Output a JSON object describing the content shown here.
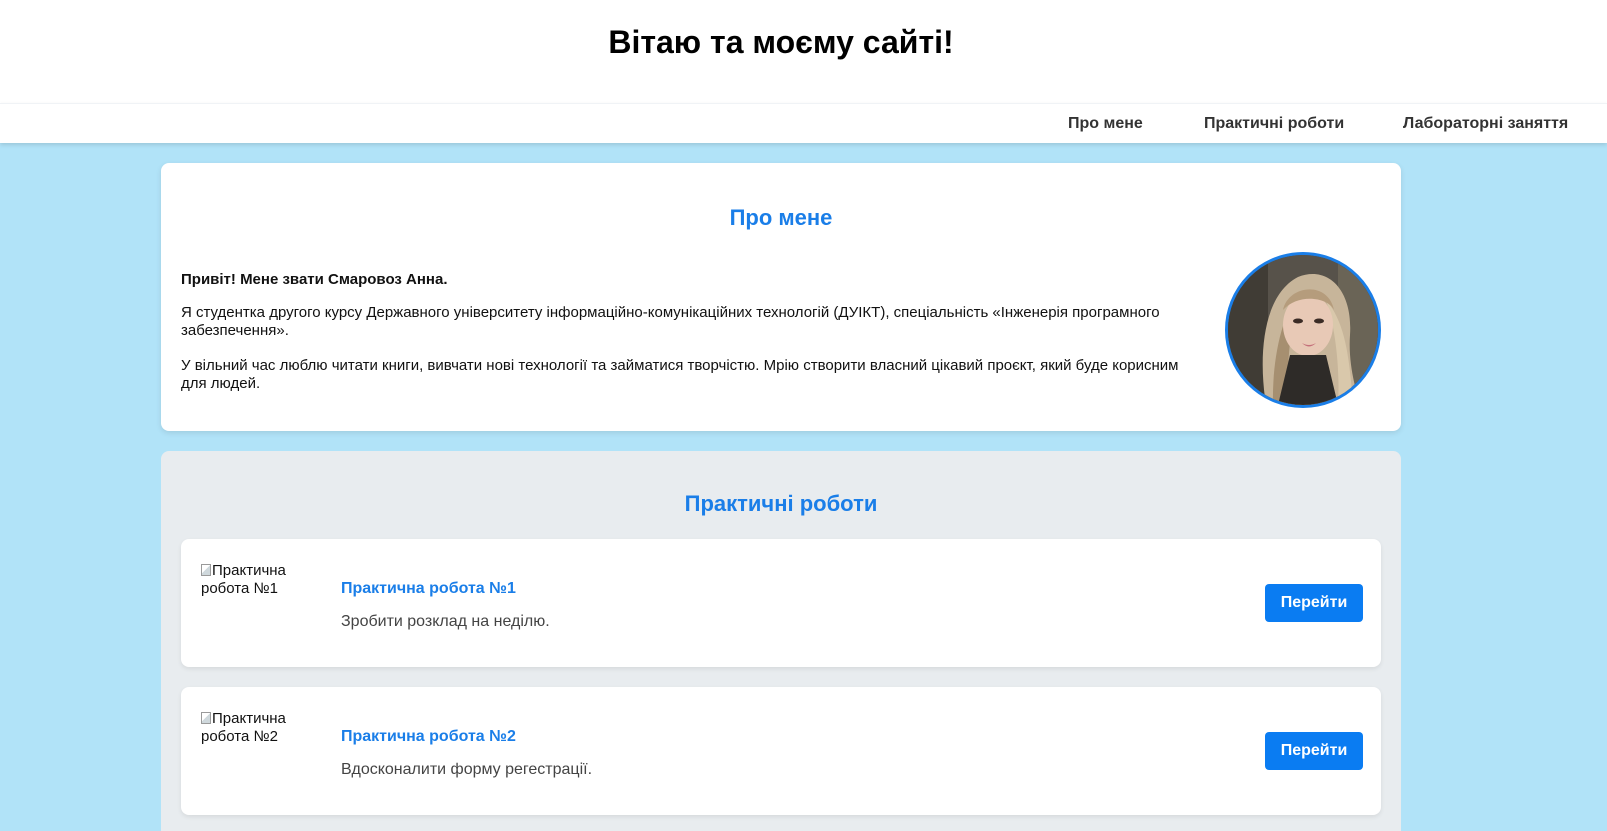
{
  "header": {
    "title": "Вітаю та моєму сайті!"
  },
  "nav": {
    "items": [
      {
        "label": "Про мене"
      },
      {
        "label": "Практичні роботи"
      },
      {
        "label": "Лабораторні заняття"
      }
    ]
  },
  "about": {
    "title": "Про мене",
    "greeting": "Привіт! Мене звати Смаровоз Анна.",
    "paragraph1": "Я студентка другого курсу Державного університету інформаційно-комунікаційних технологій (ДУІКТ), спеціальність «Інженерія програмного забезпечення».",
    "paragraph2": "У вільний час люблю читати книги, вивчати нові технології та займатися творчістю. Мрію створити власний цікавий проєкт, який буде корисним для людей."
  },
  "works": {
    "title": "Практичні роботи",
    "items": [
      {
        "image_alt": "Практична робота №1",
        "title": "Практична робота №1",
        "description": "Зробити розклад на неділю.",
        "button_label": "Перейти"
      },
      {
        "image_alt": "Практична робота №2",
        "title": "Практична робота №2",
        "description": "Вдосконалити форму регестрації.",
        "button_label": "Перейти"
      }
    ]
  },
  "colors": {
    "page_background": "#b1e3f8",
    "accent": "#1a7ee8",
    "button": "#0a7cf2",
    "works_background": "#e8ecef"
  }
}
